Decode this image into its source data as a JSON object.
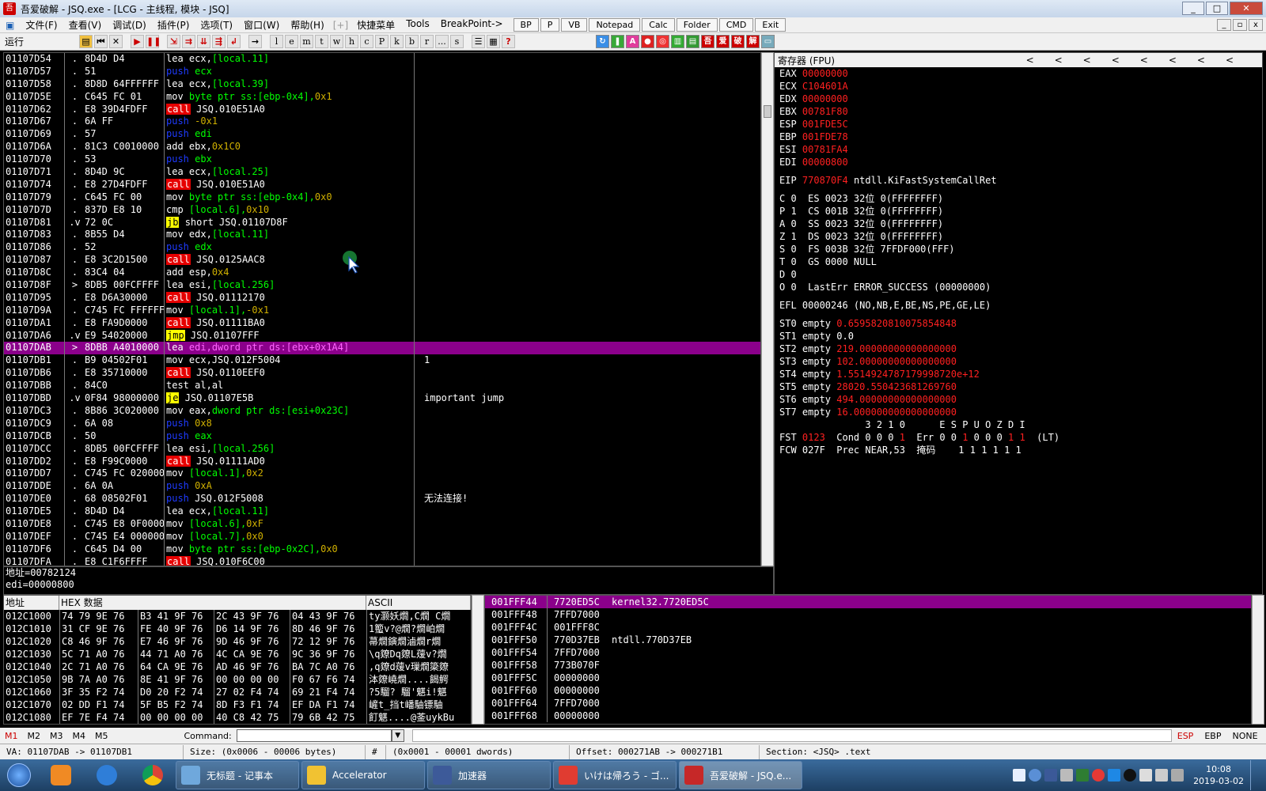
{
  "window": {
    "title": "吾爱破解 - JSQ.exe - [LCG - 主线程, 模块 - JSQ]",
    "min_label": "_",
    "max_label": "□",
    "close_label": "✕"
  },
  "menu": {
    "items": [
      "文件(F)",
      "查看(V)",
      "调试(D)",
      "插件(P)",
      "选项(T)",
      "窗口(W)",
      "帮助(H)"
    ],
    "bracket": "[+]",
    "extra_items": [
      "快捷菜单",
      "Tools",
      "BreakPoint->"
    ],
    "tool_buttons": [
      "BP",
      "P",
      "VB",
      "Notepad",
      "Calc",
      "Folder",
      "CMD",
      "Exit"
    ]
  },
  "toolbar": {
    "status": "运行",
    "letters": [
      "l",
      "e",
      "m",
      "t",
      "w",
      "h",
      "c",
      "P",
      "k",
      "b",
      "r",
      "...",
      "s"
    ]
  },
  "disasm": {
    "rows": [
      {
        "addr": "01107D54",
        "mk": ".",
        "hex": "8D4D D4",
        "mn": "lea",
        "mc": "",
        "ops": [
          {
            "t": "ecx,",
            "c": ""
          },
          {
            "t": "[local.11]",
            "c": "mem"
          }
        ],
        "cmt": ""
      },
      {
        "addr": "01107D57",
        "mk": ".",
        "hex": "51",
        "mn": "push",
        "mc": "push",
        "ops": [
          {
            "t": "ecx",
            "c": "mem"
          }
        ],
        "cmt": ""
      },
      {
        "addr": "01107D58",
        "mk": ".",
        "hex": "8D8D 64FFFFFF",
        "mn": "lea",
        "mc": "",
        "ops": [
          {
            "t": "ecx,",
            "c": ""
          },
          {
            "t": "[local.39]",
            "c": "mem"
          }
        ],
        "cmt": ""
      },
      {
        "addr": "01107D5E",
        "mk": ".",
        "hex": "C645 FC 01",
        "mn": "mov",
        "mc": "",
        "ops": [
          {
            "t": "byte ptr ss:[ebp-0x4],",
            "c": "mem"
          },
          {
            "t": "0x1",
            "c": "imm"
          }
        ],
        "cmt": ""
      },
      {
        "addr": "01107D62",
        "mk": ".",
        "hex": "E8 39D4FDFF",
        "mn": "call",
        "mc": "call",
        "ops": [
          {
            "t": "JSQ.010E51A0",
            "c": ""
          }
        ],
        "cmt": ""
      },
      {
        "addr": "01107D67",
        "mk": ".",
        "hex": "6A FF",
        "mn": "push",
        "mc": "push",
        "ops": [
          {
            "t": "-0x1",
            "c": "imm"
          }
        ],
        "cmt": ""
      },
      {
        "addr": "01107D69",
        "mk": ".",
        "hex": "57",
        "mn": "push",
        "mc": "push",
        "ops": [
          {
            "t": "edi",
            "c": "mem"
          }
        ],
        "cmt": ""
      },
      {
        "addr": "01107D6A",
        "mk": ".",
        "hex": "81C3 C0010000",
        "mn": "add",
        "mc": "",
        "ops": [
          {
            "t": "ebx,",
            "c": ""
          },
          {
            "t": "0x1C0",
            "c": "imm"
          }
        ],
        "cmt": ""
      },
      {
        "addr": "01107D70",
        "mk": ".",
        "hex": "53",
        "mn": "push",
        "mc": "push",
        "ops": [
          {
            "t": "ebx",
            "c": "mem"
          }
        ],
        "cmt": ""
      },
      {
        "addr": "01107D71",
        "mk": ".",
        "hex": "8D4D 9C",
        "mn": "lea",
        "mc": "",
        "ops": [
          {
            "t": "ecx,",
            "c": ""
          },
          {
            "t": "[local.25]",
            "c": "mem"
          }
        ],
        "cmt": ""
      },
      {
        "addr": "01107D74",
        "mk": ".",
        "hex": "E8 27D4FDFF",
        "mn": "call",
        "mc": "call",
        "ops": [
          {
            "t": "JSQ.010E51A0",
            "c": ""
          }
        ],
        "cmt": ""
      },
      {
        "addr": "01107D79",
        "mk": ".",
        "hex": "C645 FC 00",
        "mn": "mov",
        "mc": "",
        "ops": [
          {
            "t": "byte ptr ss:[ebp-0x4],",
            "c": "mem"
          },
          {
            "t": "0x0",
            "c": "imm"
          }
        ],
        "cmt": ""
      },
      {
        "addr": "01107D7D",
        "mk": ".",
        "hex": "837D E8 10",
        "mn": "cmp",
        "mc": "",
        "ops": [
          {
            "t": "[local.6],",
            "c": "mem"
          },
          {
            "t": "0x10",
            "c": "imm"
          }
        ],
        "cmt": ""
      },
      {
        "addr": "01107D81",
        "mk": ".v",
        "hex": "72 0C",
        "mn": "jb",
        "mc": "jcc",
        "ops": [
          {
            "t": "short JSQ.01107D8F",
            "c": ""
          }
        ],
        "cmt": ""
      },
      {
        "addr": "01107D83",
        "mk": ".",
        "hex": "8B55 D4",
        "mn": "mov",
        "mc": "",
        "ops": [
          {
            "t": "edx,",
            "c": ""
          },
          {
            "t": "[local.11]",
            "c": "mem"
          }
        ],
        "cmt": ""
      },
      {
        "addr": "01107D86",
        "mk": ".",
        "hex": "52",
        "mn": "push",
        "mc": "push",
        "ops": [
          {
            "t": "edx",
            "c": "mem"
          }
        ],
        "cmt": ""
      },
      {
        "addr": "01107D87",
        "mk": ".",
        "hex": "E8 3C2D1500",
        "mn": "call",
        "mc": "call",
        "ops": [
          {
            "t": "JSQ.0125AAC8",
            "c": ""
          }
        ],
        "cmt": ""
      },
      {
        "addr": "01107D8C",
        "mk": ".",
        "hex": "83C4 04",
        "mn": "add",
        "mc": "",
        "ops": [
          {
            "t": "esp,",
            "c": ""
          },
          {
            "t": "0x4",
            "c": "imm"
          }
        ],
        "cmt": ""
      },
      {
        "addr": "01107D8F",
        "mk": ">",
        "hex": "8DB5 00FCFFFF",
        "mn": "lea",
        "mc": "",
        "ops": [
          {
            "t": "esi,",
            "c": ""
          },
          {
            "t": "[local.256]",
            "c": "mem"
          }
        ],
        "cmt": ""
      },
      {
        "addr": "01107D95",
        "mk": ".",
        "hex": "E8 D6A30000",
        "mn": "call",
        "mc": "call",
        "ops": [
          {
            "t": "JSQ.01112170",
            "c": ""
          }
        ],
        "cmt": ""
      },
      {
        "addr": "01107D9A",
        "mk": ".",
        "hex": "C745 FC FFFFFFFF",
        "mn": "mov",
        "mc": "",
        "ops": [
          {
            "t": "[local.1],",
            "c": "mem"
          },
          {
            "t": "-0x1",
            "c": "imm"
          }
        ],
        "cmt": ""
      },
      {
        "addr": "01107DA1",
        "mk": ".",
        "hex": "E8 FA9D0000",
        "mn": "call",
        "mc": "call",
        "ops": [
          {
            "t": "JSQ.01111BA0",
            "c": ""
          }
        ],
        "cmt": ""
      },
      {
        "addr": "01107DA6",
        "mk": ".v",
        "hex": "E9 54020000",
        "mn": "jmp",
        "mc": "jmp",
        "ops": [
          {
            "t": "JSQ.01107FFF",
            "c": ""
          }
        ],
        "cmt": ""
      },
      {
        "addr": "01107DAB",
        "mk": ">",
        "hex": "8DBB A4010000",
        "mn": "lea",
        "mc": "sel",
        "ops": [
          {
            "t": "edi,",
            "c": ""
          },
          {
            "t": "dword ptr ds:[ebx+0x1A4]",
            "c": "mem"
          }
        ],
        "cmt": "",
        "sel": true
      },
      {
        "addr": "01107DB1",
        "mk": ".",
        "hex": "B9 04502F01",
        "mn": "mov",
        "mc": "",
        "ops": [
          {
            "t": "ecx,JSQ.012F5004",
            "c": ""
          }
        ],
        "cmt": "1"
      },
      {
        "addr": "01107DB6",
        "mk": ".",
        "hex": "E8 35710000",
        "mn": "call",
        "mc": "call",
        "ops": [
          {
            "t": "JSQ.0110EEF0",
            "c": ""
          }
        ],
        "cmt": ""
      },
      {
        "addr": "01107DBB",
        "mk": ".",
        "hex": "84C0",
        "mn": "test",
        "mc": "",
        "ops": [
          {
            "t": "al,al",
            "c": ""
          }
        ],
        "cmt": ""
      },
      {
        "addr": "01107DBD",
        "mk": ".v",
        "hex": "0F84 98000000",
        "mn": "je",
        "mc": "jcc",
        "ops": [
          {
            "t": "JSQ.01107E5B",
            "c": ""
          }
        ],
        "cmt": "important jump"
      },
      {
        "addr": "01107DC3",
        "mk": ".",
        "hex": "8B86 3C020000",
        "mn": "mov",
        "mc": "",
        "ops": [
          {
            "t": "eax,",
            "c": ""
          },
          {
            "t": "dword ptr ds:[esi+0x23C]",
            "c": "mem"
          }
        ],
        "cmt": ""
      },
      {
        "addr": "01107DC9",
        "mk": ".",
        "hex": "6A 08",
        "mn": "push",
        "mc": "push",
        "ops": [
          {
            "t": "0x8",
            "c": "imm"
          }
        ],
        "cmt": ""
      },
      {
        "addr": "01107DCB",
        "mk": ".",
        "hex": "50",
        "mn": "push",
        "mc": "push",
        "ops": [
          {
            "t": "eax",
            "c": "mem"
          }
        ],
        "cmt": ""
      },
      {
        "addr": "01107DCC",
        "mk": ".",
        "hex": "8DB5 00FCFFFF",
        "mn": "lea",
        "mc": "",
        "ops": [
          {
            "t": "esi,",
            "c": ""
          },
          {
            "t": "[local.256]",
            "c": "mem"
          }
        ],
        "cmt": ""
      },
      {
        "addr": "01107DD2",
        "mk": ".",
        "hex": "E8 F99C0000",
        "mn": "call",
        "mc": "call",
        "ops": [
          {
            "t": "JSQ.01111AD0",
            "c": ""
          }
        ],
        "cmt": ""
      },
      {
        "addr": "01107DD7",
        "mk": ".",
        "hex": "C745 FC 02000000",
        "mn": "mov",
        "mc": "",
        "ops": [
          {
            "t": "[local.1],",
            "c": "mem"
          },
          {
            "t": "0x2",
            "c": "imm"
          }
        ],
        "cmt": ""
      },
      {
        "addr": "01107DDE",
        "mk": ".",
        "hex": "6A 0A",
        "mn": "push",
        "mc": "push",
        "ops": [
          {
            "t": "0xA",
            "c": "imm"
          }
        ],
        "cmt": ""
      },
      {
        "addr": "01107DE0",
        "mk": ".",
        "hex": "68 08502F01",
        "mn": "push",
        "mc": "push",
        "ops": [
          {
            "t": "JSQ.012F5008",
            "c": ""
          }
        ],
        "cmt": "无法连接!"
      },
      {
        "addr": "01107DE5",
        "mk": ".",
        "hex": "8D4D D4",
        "mn": "lea",
        "mc": "",
        "ops": [
          {
            "t": "ecx,",
            "c": ""
          },
          {
            "t": "[local.11]",
            "c": "mem"
          }
        ],
        "cmt": ""
      },
      {
        "addr": "01107DE8",
        "mk": ".",
        "hex": "C745 E8 0F000000",
        "mn": "mov",
        "mc": "",
        "ops": [
          {
            "t": "[local.6],",
            "c": "mem"
          },
          {
            "t": "0xF",
            "c": "imm"
          }
        ],
        "cmt": ""
      },
      {
        "addr": "01107DEF",
        "mk": ".",
        "hex": "C745 E4 00000000",
        "mn": "mov",
        "mc": "",
        "ops": [
          {
            "t": "[local.7],",
            "c": "mem"
          },
          {
            "t": "0x0",
            "c": "imm"
          }
        ],
        "cmt": ""
      },
      {
        "addr": "01107DF6",
        "mk": ".",
        "hex": "C645 D4 00",
        "mn": "mov",
        "mc": "",
        "ops": [
          {
            "t": "byte ptr ss:[ebp-0x2C],",
            "c": "mem"
          },
          {
            "t": "0x0",
            "c": "imm"
          }
        ],
        "cmt": ""
      },
      {
        "addr": "01107DFA",
        "mk": ".",
        "hex": "E8 C1F6FFFF",
        "mn": "call",
        "mc": "call",
        "ops": [
          {
            "t": "JSQ.010F6C00",
            "c": ""
          }
        ],
        "cmt": ""
      }
    ]
  },
  "info": {
    "line1": "地址=00782124",
    "line2": "edi=00000800"
  },
  "registers": {
    "title": "寄存器 (FPU)",
    "arrows": "<<<<<<<<",
    "gprs": [
      {
        "name": "EAX",
        "val": "00000000",
        "note": ""
      },
      {
        "name": "ECX",
        "val": "C104601A",
        "note": ""
      },
      {
        "name": "EDX",
        "val": "00000000",
        "note": ""
      },
      {
        "name": "EBX",
        "val": "00781F80",
        "note": ""
      },
      {
        "name": "ESP",
        "val": "001FDE5C",
        "note": ""
      },
      {
        "name": "EBP",
        "val": "001FDE78",
        "note": ""
      },
      {
        "name": "ESI",
        "val": "00781FA4",
        "note": ""
      },
      {
        "name": "EDI",
        "val": "00000800",
        "note": ""
      }
    ],
    "eip": {
      "name": "EIP",
      "val": "770870F4",
      "note": " ntdll.KiFastSystemCallRet"
    },
    "flags": [
      "C 0  ES 0023 32位 0(FFFFFFFF)",
      "P 1  CS 001B 32位 0(FFFFFFFF)",
      "A 0  SS 0023 32位 0(FFFFFFFF)",
      "Z 1  DS 0023 32位 0(FFFFFFFF)",
      "S 0  FS 003B 32位 7FFDF000(FFF)",
      "T 0  GS 0000 NULL",
      "D 0",
      "O 0  LastErr ERROR_SUCCESS (00000000)"
    ],
    "efl": "EFL 00000246 (NO,NB,E,BE,NS,PE,GE,LE)",
    "st": [
      {
        "name": "ST0 empty ",
        "val": "0.6595820810075854848"
      },
      {
        "name": "ST1 empty ",
        "val": "0.0",
        "white": true
      },
      {
        "name": "ST2 empty ",
        "val": "219.00000000000000000"
      },
      {
        "name": "ST3 empty ",
        "val": "102.00000000000000000"
      },
      {
        "name": "ST4 empty ",
        "val": "1.5514924787179998720e+12"
      },
      {
        "name": "ST5 empty ",
        "val": "28020.550423681269760"
      },
      {
        "name": "ST6 empty ",
        "val": "494.00000000000000000"
      },
      {
        "name": "ST7 empty ",
        "val": "16.000000000000000000"
      }
    ],
    "fpu_header": "               3 2 1 0      E S P U O Z D I",
    "fst_label": "FST ",
    "fst_val": "0123",
    "fst_rest_a": "  Cond 0 0 0 ",
    "fst_cond_last": "1",
    "fst_rest_b": "  Err 0 0 ",
    "fst_err_a": "1",
    "fst_rest_c": " 0 0 0 ",
    "fst_err_b": "1 1",
    "fst_tail": "  (LT)",
    "fcw": "FCW 027F  Prec NEAR,53  掩码    1 1 1 1 1 1"
  },
  "dump": {
    "headers": [
      "地址",
      "HEX 数据",
      "ASCII"
    ],
    "rows": [
      {
        "a": "012C1000",
        "h": "74 79 9E 76|B3 41 9F 76|2C 43 9F 76|04 43 9F 76",
        "s": "ty灏妖燗,C燗 C燗"
      },
      {
        "a": "012C1010",
        "h": "31 CF 9E 76|FE 40 9F 76|D6 14 9F 76|8D 46 9F 76",
        "s": "1蠞v?@燗?燗岶燗"
      },
      {
        "a": "012C1020",
        "h": "C8 46 9F 76|E7 46 9F 76|9D 46 9F 76|72 12 9F 76",
        "s": "菷燗鏔燗滷燗r燗"
      },
      {
        "a": "012C1030",
        "h": "5C 71 A0 76|44 71 A0 76|4C CA 9E 76|9C 36 9F 76",
        "s": "\\q爒Dq爒L蕿v?燗"
      },
      {
        "a": "012C1040",
        "h": "2C 71 A0 76|64 CA 9E 76|AD 46 9F 76|BA 7C A0 76",
        "s": ",q爒d蕿v璅燗簗爒"
      },
      {
        "a": "012C1050",
        "h": "9B 7A A0 76|8E 41 9F 76|00 00 00 00|F0 67 F6 74",
        "s": "泍爒嶢燗....餲鰐"
      },
      {
        "a": "012C1060",
        "h": "3F 35 F2 74|D0 20 F2 74|27 02 F4 74|69 21 F4 74",
        "s": "?5騮? 騮'魌i!魌"
      },
      {
        "a": "012C1070",
        "h": "02 DD F1 74|5F B5 F2 74|8D F3 F1 74|EF DA F1 74",
        "s": "嵼t_挡t嶓駎镖駎"
      },
      {
        "a": "012C1080",
        "h": "EF 7E F4 74|00 00 00 00|40 C8 42 75|79 6B 42 75",
        "s": "飣魌....@菳uykBu"
      }
    ]
  },
  "stack": {
    "rows": [
      {
        "a": "001FFF44",
        "v": "7720ED5C",
        "c": "kernel32.7720ED5C",
        "sel": true
      },
      {
        "a": "001FFF48",
        "v": "7FFD7000",
        "c": ""
      },
      {
        "a": "001FFF4C",
        "v": "001FFF8C",
        "c": ""
      },
      {
        "a": "001FFF50",
        "v": "770D37EB",
        "c": "ntdll.770D37EB"
      },
      {
        "a": "001FFF54",
        "v": "7FFD7000",
        "c": ""
      },
      {
        "a": "001FFF58",
        "v": "773B070F",
        "c": ""
      },
      {
        "a": "001FFF5C",
        "v": "00000000",
        "c": ""
      },
      {
        "a": "001FFF60",
        "v": "00000000",
        "c": ""
      },
      {
        "a": "001FFF64",
        "v": "7FFD7000",
        "c": ""
      },
      {
        "a": "001FFF68",
        "v": "00000000",
        "c": ""
      }
    ]
  },
  "command": {
    "tabs": [
      "M1",
      "M2",
      "M3",
      "M4",
      "M5"
    ],
    "label": "Command:",
    "flags": [
      "ESP",
      "EBP",
      "NONE"
    ]
  },
  "status": {
    "va": "VA: 01107DAB -> 01107DB1",
    "size": "Size: (0x0006 - 00006 bytes)",
    "hash": "#",
    "dwords": "(0x0001 - 00001 dwords)",
    "offset": "Offset: 000271AB -> 000271B1",
    "section": "Section: <JSQ> .text"
  },
  "taskbar": {
    "apps": [
      {
        "label": "无标题 - 记事本",
        "color": "#6fa8dc"
      },
      {
        "label": "Accelerator",
        "color": "#f1c232"
      },
      {
        "label": "加速器",
        "color": "#3d5a99"
      },
      {
        "label": "いけは帰ろう - ゴ...",
        "color": "#e03c31"
      },
      {
        "label": "吾爱破解 - JSQ.e...",
        "color": "#c62828"
      }
    ],
    "time": "10:08",
    "date": "2019-03-02"
  },
  "colors": {
    "selection": "#8b008b",
    "register_value": "#ff2020",
    "push": "#1f3bff",
    "call_bg": "#e60000",
    "jump_bg": "#ffff00",
    "memory_operand": "#00ff00"
  }
}
